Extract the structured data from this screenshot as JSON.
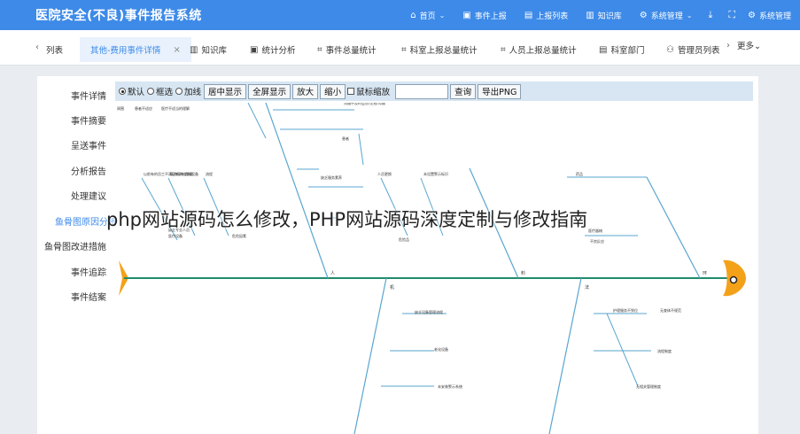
{
  "app": {
    "title": "医院安全(不良)事件报告系统"
  },
  "nav": [
    {
      "icon": "home-icon",
      "glyph": "⌂",
      "label": "首页",
      "caret": true
    },
    {
      "icon": "report-icon",
      "glyph": "▣",
      "label": "事件上报",
      "caret": false
    },
    {
      "icon": "list-icon",
      "glyph": "▤",
      "label": "上报列表",
      "caret": false
    },
    {
      "icon": "book-icon",
      "glyph": "▥",
      "label": "知识库",
      "caret": false
    },
    {
      "icon": "settings-icon",
      "glyph": "⚙",
      "label": "系统管理",
      "caret": true
    }
  ],
  "nav_tools": {
    "download_icon": "download-icon",
    "fullscreen_icon": "fullscreen-icon",
    "user_label": "系统管理"
  },
  "tabs": [
    {
      "label": "列表",
      "active": false
    },
    {
      "label": "其他-费用事件详情",
      "active": true
    },
    {
      "label": "知识库",
      "active": false,
      "icon": "book-icon"
    },
    {
      "label": "统计分析",
      "active": false,
      "icon": "chart-icon"
    },
    {
      "label": "事件总量统计",
      "active": false,
      "icon": "grid-icon"
    },
    {
      "label": "科室上报总量统计",
      "active": false,
      "icon": "grid-icon"
    },
    {
      "label": "人员上报总量统计",
      "active": false,
      "icon": "grid-icon"
    },
    {
      "label": "科室部门",
      "active": false,
      "icon": "doc-icon"
    },
    {
      "label": "管理员列表",
      "active": false,
      "icon": "user-icon"
    }
  ],
  "tab_more": "更多",
  "side_menu": [
    {
      "label": "事件详情",
      "active": false
    },
    {
      "label": "事件摘要",
      "active": false
    },
    {
      "label": "呈送事件",
      "active": false
    },
    {
      "label": "分析报告",
      "active": false
    },
    {
      "label": "处理建议",
      "active": false
    },
    {
      "label": "鱼骨图原因分析",
      "active": true
    },
    {
      "label": "鱼骨图改进措施",
      "active": false
    },
    {
      "label": "事件追踪",
      "active": false
    },
    {
      "label": "事件结案",
      "active": false
    }
  ],
  "toolbar": {
    "mode_default": "默认",
    "mode_select": "框选",
    "mode_add": "加线",
    "center_btn": "居中显示",
    "fullscreen_btn": "全屏显示",
    "zoom_in_btn": "放大",
    "zoom_out_btn": "缩小",
    "wheel_zoom": "鼠标缩放",
    "query_btn": "查询",
    "export_btn": "导出PNG"
  },
  "fishbone": {
    "spine_color": "#1f8a6e",
    "head_color": "#f4a11a",
    "bone_color": "#5aa6cf",
    "categories_top": [
      "人",
      "料",
      "环"
    ],
    "categories_bottom": [
      "机",
      "法"
    ],
    "top_left_labels": [
      "周围",
      "患者不适应",
      "医疗不适当的理解"
    ],
    "labels_top": [
      "沟通不及时会诊/交班/沟通",
      "患者",
      "缺乏服务素养",
      "以前有的员工不满足新岗位需要",
      "医院现有临床设备",
      "流程",
      "缺乏专业人员",
      "医疗设备",
      "危险因素",
      "人员更换",
      "未设置警示标识",
      "危险品",
      "药品",
      "不良反应",
      "医疗器械",
      "设备不足",
      "未设置提示"
    ],
    "labels_bottom": [
      "缺乏设备管理流程",
      "老化设备",
      "未安装警示系统",
      "护理服务不到位",
      "无查体不规范",
      "流程制度",
      "无相关管理制度"
    ]
  },
  "watermark": "php网站源码怎么修改，PHP网站源码深度定制与修改指南"
}
